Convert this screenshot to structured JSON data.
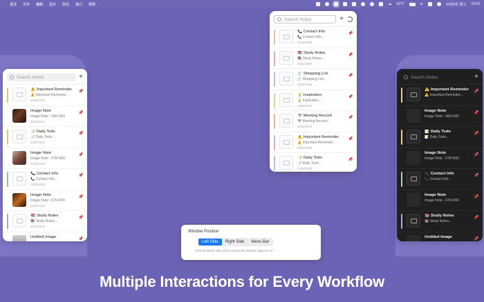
{
  "menubar": {
    "menus": [
      "语法",
      "文件",
      "编辑",
      "显示",
      "前往",
      "窗口",
      "帮助"
    ],
    "weather": "22°C",
    "date": "10月8日 周三",
    "time": "14:23"
  },
  "search_placeholder": "Search Notes",
  "left_panel": {
    "items": [
      {
        "title": "⚠️ Important Reminder",
        "subtitle": "⚠️ Important Reminder...",
        "date": "2025/10/16",
        "bar": "#e7c45a",
        "thumb": "doc"
      },
      {
        "title": "Image Note",
        "subtitle": "Image Note - 680×383",
        "date": "2025/10/16",
        "bar": "",
        "thumb": "photo-a"
      },
      {
        "title": "📝 Daily Todo",
        "subtitle": "📝 Daily Todo...",
        "date": "2025/10/16",
        "bar": "#e7c45a",
        "thumb": "doc"
      },
      {
        "title": "Image Note",
        "subtitle": "Image Note - 678×900",
        "date": "2025/10/16",
        "bar": "",
        "thumb": "photo-b"
      },
      {
        "title": "📞 Contact Info",
        "subtitle": "📞 Contact Info...",
        "date": "2025/10/16",
        "bar": "#8cc49a",
        "thumb": "doc"
      },
      {
        "title": "Image Note",
        "subtitle": "Image Note - 676×900",
        "date": "2025/10/16",
        "bar": "",
        "thumb": "photo-c"
      },
      {
        "title": "📚 Study Notes",
        "subtitle": "📚 Study Notes...",
        "date": "2025/10/16",
        "bar": "#9ea2e6",
        "thumb": "doc"
      },
      {
        "title": "Untitled Image",
        "subtitle": "",
        "date": "",
        "bar": "",
        "thumb": "photo-d"
      }
    ]
  },
  "top_panel": {
    "items": [
      {
        "title": "📞 Contact Info",
        "subtitle": "📞 Contact Info...",
        "date": "2025/10/08",
        "bar": "#e9c09a",
        "thumb": "doc"
      },
      {
        "title": "📚 Study Notes",
        "subtitle": "📚 Study Notes...",
        "date": "2025/10/08",
        "bar": "#e2a7b8",
        "thumb": "doc"
      },
      {
        "title": "🛒 Shopping List",
        "subtitle": "🛒 Shopping List...",
        "date": "2025/10/08",
        "bar": "#b7bde9",
        "thumb": "doc"
      },
      {
        "title": "💡 Inspiration",
        "subtitle": "💡 Inspiration...",
        "date": "2025/10/08",
        "bar": "#e7d48a",
        "thumb": "doc"
      },
      {
        "title": "📅 Meeting Record",
        "subtitle": "📅 Meeting Record...",
        "date": "2025/10/08",
        "bar": "#e9b48e",
        "thumb": "doc"
      },
      {
        "title": "⚠️ Important Reminder",
        "subtitle": "⚠️ Important Reminder...",
        "date": "2025/10/08",
        "bar": "#d8a8e0",
        "thumb": "doc"
      },
      {
        "title": "📝 Daily Todo",
        "subtitle": "📝 Daily Todo...",
        "date": "2025/10/08",
        "bar": "#a9c2ec",
        "thumb": "doc"
      }
    ]
  },
  "right_panel": {
    "items": [
      {
        "title": "⚠️ Important Reminder",
        "subtitle": "⚠️ Important Reminder...",
        "date": "",
        "bar": "#e7d28f",
        "thumb": "doc"
      },
      {
        "title": "Image Note",
        "subtitle": "Image Note - 680×383",
        "date": "",
        "bar": "",
        "thumb": "photo-a"
      },
      {
        "title": "📝 Daily Todo",
        "subtitle": "📝 Daily Todo...",
        "date": "",
        "bar": "#e7d28f",
        "thumb": "doc"
      },
      {
        "title": "Image Note",
        "subtitle": "Image Note - 678×900",
        "date": "",
        "bar": "",
        "thumb": "photo-b"
      },
      {
        "title": "📞 Contact Info",
        "subtitle": "📞 Contact Info...",
        "date": "",
        "bar": "#a8d4b0",
        "thumb": "doc"
      },
      {
        "title": "Image Note",
        "subtitle": "Image Note - 676×900",
        "date": "",
        "bar": "",
        "thumb": "photo-c"
      },
      {
        "title": "📚 Study Notes",
        "subtitle": "📚 Study Notes...",
        "date": "",
        "bar": "#a9aeec",
        "thumb": "doc"
      },
      {
        "title": "Untitled Image",
        "subtitle": "",
        "date": "",
        "bar": "",
        "thumb": "photo-d"
      }
    ]
  },
  "settings": {
    "title": "Window Position",
    "options": [
      "Left Side",
      "Right Side",
      "Menu Bar"
    ],
    "selected": "Left Side",
    "description": "Choose which side of the screen the window appears on"
  },
  "headline": "Multiple Interactions for Every Workflow",
  "colors": {
    "accent": "#1677ff",
    "pin": "#e8892a",
    "background": "#6b63b5"
  }
}
